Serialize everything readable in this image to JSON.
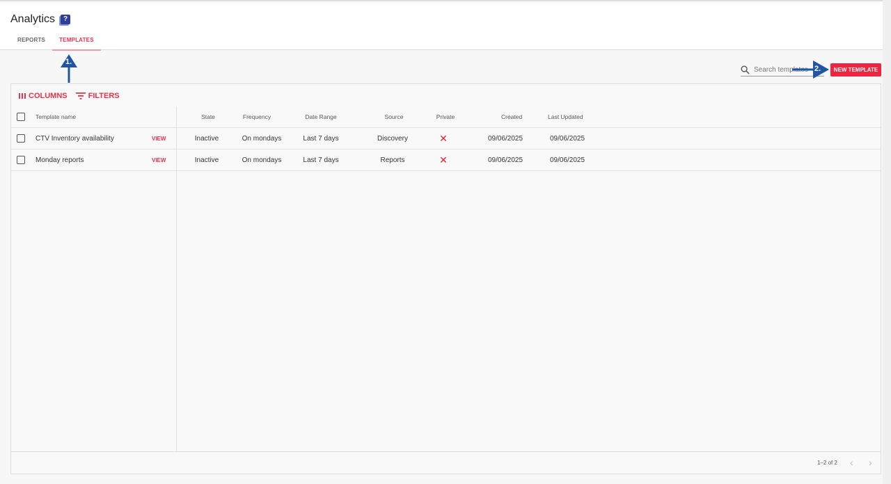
{
  "header": {
    "title": "Analytics",
    "help_icon": "?"
  },
  "tabs": [
    {
      "label": "REPORTS"
    },
    {
      "label": "TEMPLATES",
      "active": true
    }
  ],
  "search": {
    "placeholder": "Search templates"
  },
  "new_template_label": "NEW TEMPLATE",
  "toolbar": {
    "columns": "COLUMNS",
    "filters": "FILTERS"
  },
  "columns": [
    "Template name",
    "State",
    "Frequency",
    "Date Range",
    "Source",
    "Private",
    "Created",
    "Last Updated"
  ],
  "rows": [
    {
      "name": "CTV Inventory availability",
      "view": "VIEW",
      "state": "Inactive",
      "frequency": "On mondays",
      "range": "Last 7 days",
      "source": "Discovery",
      "private": "✕",
      "created": "09/06/2025",
      "updated": "09/06/2025"
    },
    {
      "name": "Monday reports",
      "view": "VIEW",
      "state": "Inactive",
      "frequency": "On mondays",
      "range": "Last 7 days",
      "source": "Reports",
      "private": "✕",
      "created": "09/06/2025",
      "updated": "09/06/2025"
    }
  ],
  "pagination": {
    "text": "1–2 of 2"
  },
  "annotations": {
    "one": "1.",
    "two": "2."
  },
  "colors": {
    "accent": "#f0243f",
    "annotation": "#1f55a3"
  }
}
